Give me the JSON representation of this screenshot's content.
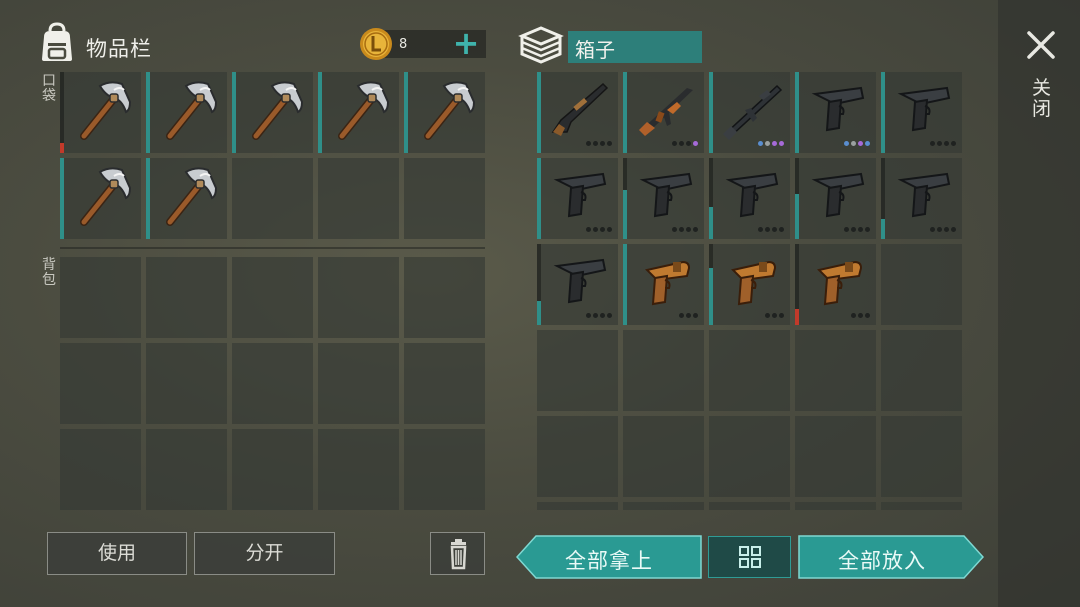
{
  "inventory": {
    "title": "物品栏",
    "pocket_label": "口袋",
    "backpack_label": "背包",
    "coins": "8",
    "pocket_slots": [
      {
        "icon": "pickaxe-icon",
        "durability": 0.12,
        "dur_color": "red"
      },
      {
        "icon": "pickaxe-icon",
        "durability": 1.0,
        "dur_color": "teal"
      },
      {
        "icon": "pickaxe-icon",
        "durability": 1.0,
        "dur_color": "teal"
      },
      {
        "icon": "pickaxe-icon",
        "durability": 1.0,
        "dur_color": "teal"
      },
      {
        "icon": "pickaxe-icon",
        "durability": 1.0,
        "dur_color": "teal"
      },
      {
        "icon": "pickaxe-icon",
        "durability": 1.0,
        "dur_color": "teal"
      },
      {
        "icon": "pickaxe-icon",
        "durability": 1.0,
        "dur_color": "teal"
      },
      {
        "icon": null
      },
      {
        "icon": null
      },
      {
        "icon": null
      }
    ],
    "backpack_slots": 15
  },
  "box": {
    "title": "箱子",
    "slots": [
      {
        "icon": "shotgun-icon",
        "durability": 1.0,
        "dots": [
          "",
          "",
          "",
          ""
        ]
      },
      {
        "icon": "ak-rifle-icon",
        "durability": 1.0,
        "dots": [
          "",
          "",
          "",
          "purple"
        ]
      },
      {
        "icon": "assault-rifle-icon",
        "durability": 1.0,
        "dots": [
          "blue",
          "grey",
          "purple",
          "purple"
        ]
      },
      {
        "icon": "pistol-icon",
        "durability": 1.0,
        "dots": [
          "blue",
          "grey",
          "purple",
          "blue"
        ]
      },
      {
        "icon": "pistol-icon",
        "durability": 1.0,
        "dots": [
          "",
          "",
          "",
          ""
        ]
      },
      {
        "icon": "pistol-icon",
        "durability": 1.0,
        "dots": [
          "",
          "",
          "",
          ""
        ]
      },
      {
        "icon": "pistol-icon",
        "durability": 0.6,
        "dots": [
          "",
          "",
          "",
          ""
        ]
      },
      {
        "icon": "pistol-icon",
        "durability": 0.4,
        "dots": [
          "",
          "",
          "",
          ""
        ]
      },
      {
        "icon": "pistol-icon",
        "durability": 0.55,
        "dots": [
          "",
          "",
          "",
          ""
        ]
      },
      {
        "icon": "pistol-icon",
        "durability": 0.25,
        "dots": [
          "",
          "",
          "",
          ""
        ]
      },
      {
        "icon": "pistol-icon",
        "durability": 0.3,
        "dots": [
          "",
          "",
          "",
          ""
        ]
      },
      {
        "icon": "flare-gun-icon",
        "durability": 1.0,
        "dots": [
          "",
          "",
          ""
        ]
      },
      {
        "icon": "flare-gun-icon",
        "durability": 0.7,
        "dots": [
          "",
          "",
          ""
        ]
      },
      {
        "icon": "flare-gun-icon",
        "durability": 0.2,
        "dur_color": "red",
        "dots": [
          "",
          "",
          ""
        ]
      },
      {
        "icon": null
      }
    ],
    "empty_rows": 2
  },
  "buttons": {
    "use": "使用",
    "split": "分开",
    "take_all": "全部拿上",
    "put_all": "全部放入",
    "close_label": "关闭"
  },
  "colors": {
    "accent": "#2d7f7a",
    "accent_light": "#3fb3ac",
    "durability_low": "#c23a2a"
  }
}
